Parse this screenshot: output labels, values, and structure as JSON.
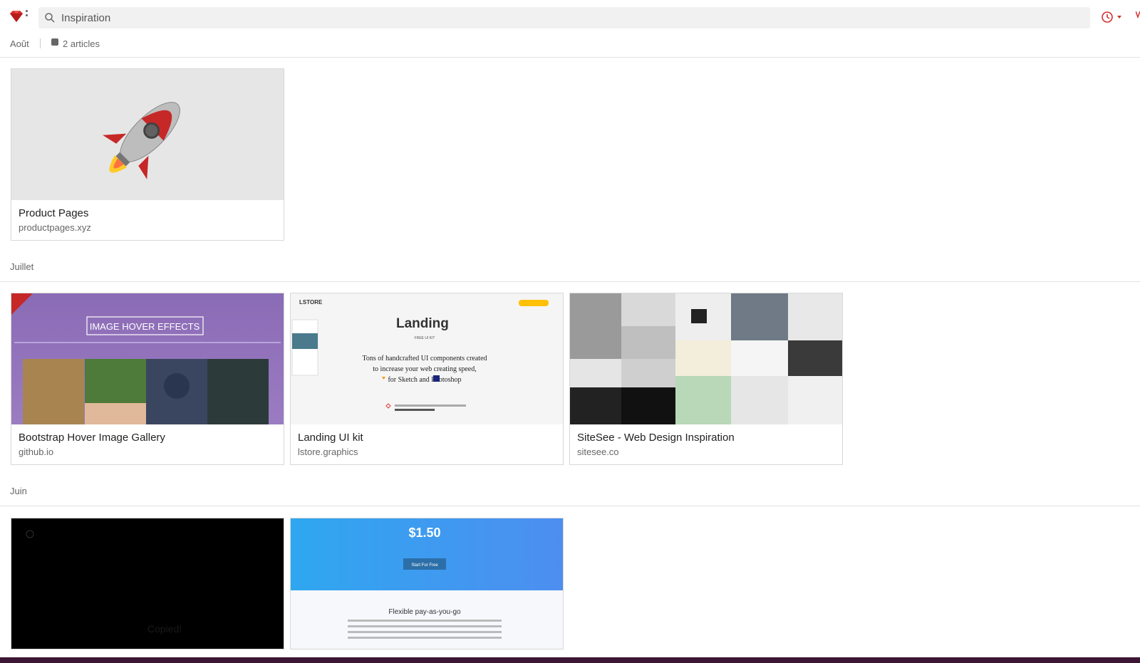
{
  "app": {
    "logo_icon": "ruby-gem-icon",
    "accent_color": "#d32f2f"
  },
  "search": {
    "value": "Inspiration",
    "icon": "search-icon"
  },
  "toolbar": {
    "history_icon": "clock-icon"
  },
  "filter": {
    "month": "Août",
    "count_icon": "note-icon",
    "count_label": "2 articles"
  },
  "sections": [
    {
      "label": "",
      "cards": [
        {
          "title": "Product Pages",
          "domain": "productpages.xyz",
          "thumb": "rocket-illustration"
        }
      ]
    },
    {
      "label": "Juillet",
      "cards": [
        {
          "title": "Bootstrap Hover Image Gallery",
          "domain": "github.io",
          "thumb": "hover-gallery-screenshot",
          "thumb_text": "IMAGE HOVER EFFECTS"
        },
        {
          "title": "Landing UI kit",
          "domain": "lstore.graphics",
          "thumb": "landing-kit-screenshot",
          "thumb_brand": "LSTORE",
          "thumb_heading": "Landing",
          "thumb_sub": "FREE UI KIT",
          "thumb_body_1": "Tons of  handcrafted UI components created",
          "thumb_body_2": "to increase your web creating speed,",
          "thumb_body_3": "for  Sketch and   Photoshop"
        },
        {
          "title": "SiteSee - Web Design Inspiration",
          "domain": "sitesee.co",
          "thumb": "sitesee-collage-screenshot"
        }
      ]
    },
    {
      "label": "Juin",
      "cards": [
        {
          "thumb": "black-screenshot",
          "thumb_text": "Copied!"
        },
        {
          "thumb": "pricing-screenshot",
          "thumb_price": "$1.50",
          "thumb_button": "Start For Free",
          "thumb_heading": "Flexible pay-as-you-go"
        }
      ]
    }
  ]
}
